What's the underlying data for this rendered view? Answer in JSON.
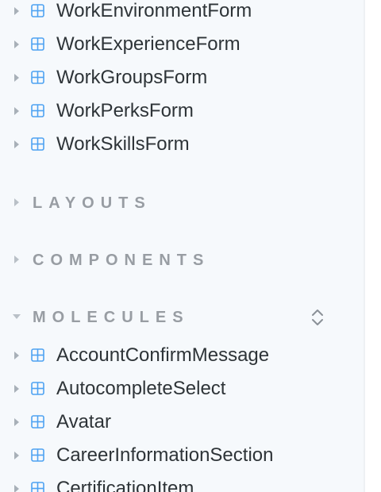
{
  "sidebar": {
    "top_items": [
      {
        "label": "WorkEnvironmentForm"
      },
      {
        "label": "WorkExperienceForm"
      },
      {
        "label": "WorkGroupsForm"
      },
      {
        "label": "WorkPerksForm"
      },
      {
        "label": "WorkSkillsForm"
      }
    ],
    "groups": {
      "layouts": {
        "title": "LAYOUTS",
        "expanded": false
      },
      "components": {
        "title": "COMPONENTS",
        "expanded": false
      },
      "molecules": {
        "title": "MOLECULES",
        "expanded": true
      }
    },
    "molecule_items": [
      {
        "label": "AccountConfirmMessage"
      },
      {
        "label": "AutocompleteSelect"
      },
      {
        "label": "Avatar"
      },
      {
        "label": "CareerInformationSection"
      },
      {
        "label": "CertificationItem"
      }
    ]
  },
  "icons": {
    "item_expander": "triangle-right-icon",
    "component_icon": "component-grid-icon",
    "group_expander_collapsed": "triangle-right-icon",
    "group_expander_expanded": "triangle-down-icon",
    "collapse_toggle": "chevron-up-down-icon"
  },
  "colors": {
    "sidebar_background": "#f6f9fc",
    "item_text": "#2e3438",
    "group_title": "#989da3",
    "component_icon": "#4ea2f2",
    "expander": "#a8b0b8"
  }
}
